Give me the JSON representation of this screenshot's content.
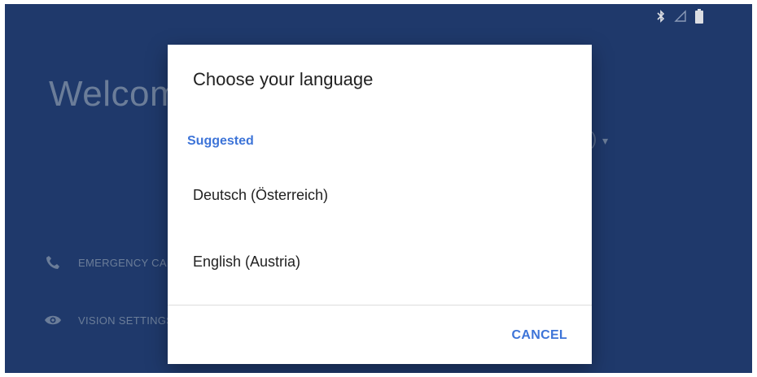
{
  "status_bar": {
    "icons": [
      "bluetooth-icon",
      "signal-icon",
      "battery-icon"
    ]
  },
  "background": {
    "welcome_text": "Welcome",
    "emergency_label": "EMERGENCY CALL",
    "vision_label": "VISION SETTINGS"
  },
  "dialog": {
    "title": "Choose your language",
    "section_label": "Suggested",
    "languages": [
      {
        "label": "Deutsch (Österreich)"
      },
      {
        "label": "English (Austria)"
      }
    ],
    "cancel_label": "CANCEL"
  },
  "colors": {
    "background": "#223e72",
    "accent": "#3d74d8",
    "dialog": "#ffffff",
    "text": "#212121"
  }
}
